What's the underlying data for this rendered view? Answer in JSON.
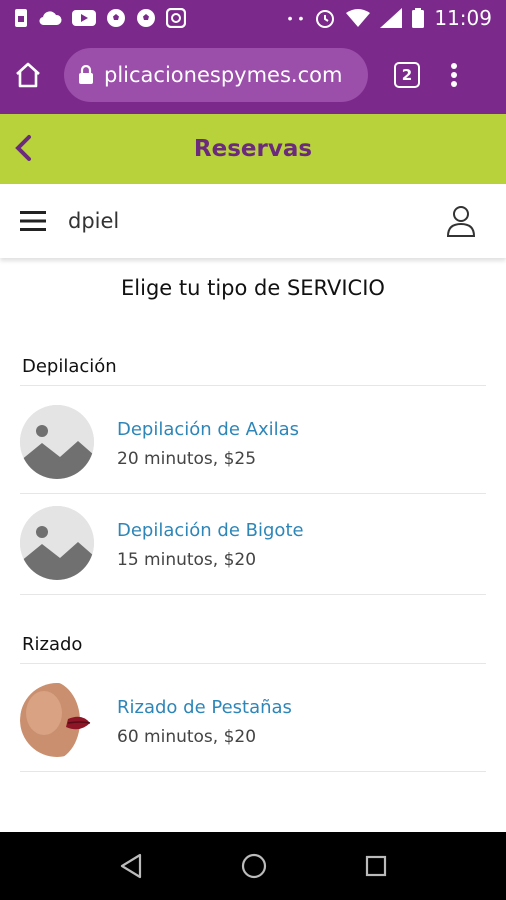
{
  "status_bar": {
    "time": "11:09",
    "icons": [
      "sim-icon",
      "cloud-icon",
      "youtube-icon",
      "soccer-ball-icon",
      "soccer-ball-icon",
      "instagram-icon",
      "more-notifications-icon",
      "alarm-icon",
      "wifi-icon",
      "signal-icon",
      "battery-icon"
    ]
  },
  "browser": {
    "url": "plicacionespymes.com",
    "tab_count": "2"
  },
  "app_header": {
    "title": "Reservas",
    "accent_color": "#b7d23a",
    "brand_color": "#7b2a8c"
  },
  "nav": {
    "shop_name": "dpiel"
  },
  "page": {
    "heading": "Elige tu tipo de SERVICIO"
  },
  "categories": [
    {
      "name": "Depilación",
      "services": [
        {
          "name": "Depilación de Axilas",
          "meta": "20 minutos, $25",
          "thumb": "placeholder-image-icon"
        },
        {
          "name": "Depilación de Bigote",
          "meta": "15 minutos, $20",
          "thumb": "placeholder-image-icon"
        }
      ]
    },
    {
      "name": "Rizado",
      "services": [
        {
          "name": "Rizado de Pestañas",
          "meta": "60 minutos, $20",
          "thumb": "face-photo"
        }
      ]
    }
  ]
}
